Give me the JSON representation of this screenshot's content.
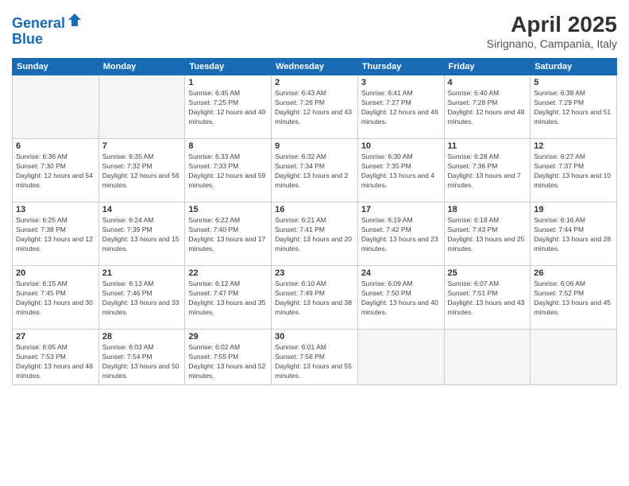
{
  "logo": {
    "line1": "General",
    "line2": "Blue"
  },
  "title": "April 2025",
  "subtitle": "Sirignano, Campania, Italy",
  "days_of_week": [
    "Sunday",
    "Monday",
    "Tuesday",
    "Wednesday",
    "Thursday",
    "Friday",
    "Saturday"
  ],
  "weeks": [
    [
      {
        "num": "",
        "info": ""
      },
      {
        "num": "",
        "info": ""
      },
      {
        "num": "1",
        "info": "Sunrise: 6:45 AM\nSunset: 7:25 PM\nDaylight: 12 hours and 40 minutes."
      },
      {
        "num": "2",
        "info": "Sunrise: 6:43 AM\nSunset: 7:26 PM\nDaylight: 12 hours and 43 minutes."
      },
      {
        "num": "3",
        "info": "Sunrise: 6:41 AM\nSunset: 7:27 PM\nDaylight: 12 hours and 46 minutes."
      },
      {
        "num": "4",
        "info": "Sunrise: 6:40 AM\nSunset: 7:28 PM\nDaylight: 12 hours and 48 minutes."
      },
      {
        "num": "5",
        "info": "Sunrise: 6:38 AM\nSunset: 7:29 PM\nDaylight: 12 hours and 51 minutes."
      }
    ],
    [
      {
        "num": "6",
        "info": "Sunrise: 6:36 AM\nSunset: 7:30 PM\nDaylight: 12 hours and 54 minutes."
      },
      {
        "num": "7",
        "info": "Sunrise: 6:35 AM\nSunset: 7:32 PM\nDaylight: 12 hours and 56 minutes."
      },
      {
        "num": "8",
        "info": "Sunrise: 6:33 AM\nSunset: 7:33 PM\nDaylight: 12 hours and 59 minutes."
      },
      {
        "num": "9",
        "info": "Sunrise: 6:32 AM\nSunset: 7:34 PM\nDaylight: 13 hours and 2 minutes."
      },
      {
        "num": "10",
        "info": "Sunrise: 6:30 AM\nSunset: 7:35 PM\nDaylight: 13 hours and 4 minutes."
      },
      {
        "num": "11",
        "info": "Sunrise: 6:28 AM\nSunset: 7:36 PM\nDaylight: 13 hours and 7 minutes."
      },
      {
        "num": "12",
        "info": "Sunrise: 6:27 AM\nSunset: 7:37 PM\nDaylight: 13 hours and 10 minutes."
      }
    ],
    [
      {
        "num": "13",
        "info": "Sunrise: 6:25 AM\nSunset: 7:38 PM\nDaylight: 13 hours and 12 minutes."
      },
      {
        "num": "14",
        "info": "Sunrise: 6:24 AM\nSunset: 7:39 PM\nDaylight: 13 hours and 15 minutes."
      },
      {
        "num": "15",
        "info": "Sunrise: 6:22 AM\nSunset: 7:40 PM\nDaylight: 13 hours and 17 minutes."
      },
      {
        "num": "16",
        "info": "Sunrise: 6:21 AM\nSunset: 7:41 PM\nDaylight: 13 hours and 20 minutes."
      },
      {
        "num": "17",
        "info": "Sunrise: 6:19 AM\nSunset: 7:42 PM\nDaylight: 13 hours and 23 minutes."
      },
      {
        "num": "18",
        "info": "Sunrise: 6:18 AM\nSunset: 7:43 PM\nDaylight: 13 hours and 25 minutes."
      },
      {
        "num": "19",
        "info": "Sunrise: 6:16 AM\nSunset: 7:44 PM\nDaylight: 13 hours and 28 minutes."
      }
    ],
    [
      {
        "num": "20",
        "info": "Sunrise: 6:15 AM\nSunset: 7:45 PM\nDaylight: 13 hours and 30 minutes."
      },
      {
        "num": "21",
        "info": "Sunrise: 6:13 AM\nSunset: 7:46 PM\nDaylight: 13 hours and 33 minutes."
      },
      {
        "num": "22",
        "info": "Sunrise: 6:12 AM\nSunset: 7:47 PM\nDaylight: 13 hours and 35 minutes."
      },
      {
        "num": "23",
        "info": "Sunrise: 6:10 AM\nSunset: 7:49 PM\nDaylight: 13 hours and 38 minutes."
      },
      {
        "num": "24",
        "info": "Sunrise: 6:09 AM\nSunset: 7:50 PM\nDaylight: 13 hours and 40 minutes."
      },
      {
        "num": "25",
        "info": "Sunrise: 6:07 AM\nSunset: 7:51 PM\nDaylight: 13 hours and 43 minutes."
      },
      {
        "num": "26",
        "info": "Sunrise: 6:06 AM\nSunset: 7:52 PM\nDaylight: 13 hours and 45 minutes."
      }
    ],
    [
      {
        "num": "27",
        "info": "Sunrise: 6:05 AM\nSunset: 7:53 PM\nDaylight: 13 hours and 48 minutes."
      },
      {
        "num": "28",
        "info": "Sunrise: 6:03 AM\nSunset: 7:54 PM\nDaylight: 13 hours and 50 minutes."
      },
      {
        "num": "29",
        "info": "Sunrise: 6:02 AM\nSunset: 7:55 PM\nDaylight: 13 hours and 52 minutes."
      },
      {
        "num": "30",
        "info": "Sunrise: 6:01 AM\nSunset: 7:56 PM\nDaylight: 13 hours and 55 minutes."
      },
      {
        "num": "",
        "info": ""
      },
      {
        "num": "",
        "info": ""
      },
      {
        "num": "",
        "info": ""
      }
    ]
  ]
}
